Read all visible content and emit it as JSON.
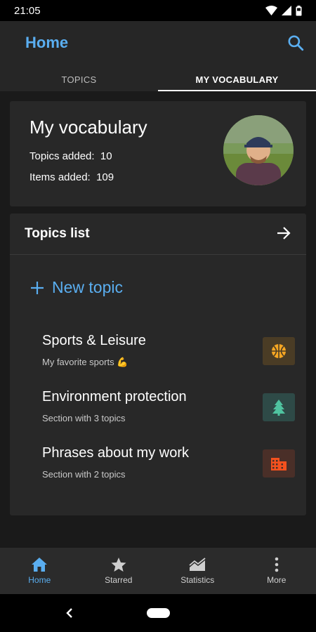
{
  "status": {
    "time": "21:05"
  },
  "app_bar": {
    "title": "Home"
  },
  "tabs": [
    {
      "label": "TOPICS",
      "active": false
    },
    {
      "label": "MY VOCABULARY",
      "active": true
    }
  ],
  "profile": {
    "title": "My vocabulary",
    "topics_added_label": "Topics added:",
    "topics_added": "10",
    "items_added_label": "Items added:",
    "items_added": "109"
  },
  "topics_list": {
    "title": "Topics list",
    "new_topic_label": "New topic",
    "items": [
      {
        "name": "Sports & Leisure",
        "subtitle": "My favorite sports 💪",
        "icon": "basketball-icon",
        "badge_color": "#4a3c25",
        "icon_color": "#f5a623"
      },
      {
        "name": "Environment protection",
        "subtitle": "Section with 3 topics",
        "icon": "tree-icon",
        "badge_color": "#2e4a47",
        "icon_color": "#4fc3a0"
      },
      {
        "name": "Phrases about my work",
        "subtitle": "Section with 2 topics",
        "icon": "building-icon",
        "badge_color": "#4a2f28",
        "icon_color": "#f4511e"
      }
    ]
  },
  "bottom_nav": [
    {
      "label": "Home",
      "icon": "home-icon",
      "active": true
    },
    {
      "label": "Starred",
      "icon": "star-icon",
      "active": false
    },
    {
      "label": "Statistics",
      "icon": "chart-icon",
      "active": false
    },
    {
      "label": "More",
      "icon": "more-vertical-icon",
      "active": false
    }
  ],
  "colors": {
    "accent": "#5aaef0",
    "background": "#1a1a1a",
    "card": "#282828"
  }
}
